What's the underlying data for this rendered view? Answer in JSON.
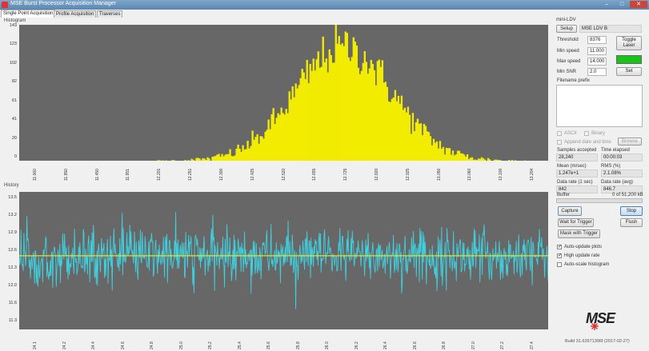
{
  "window": {
    "title": "MSE Burst Processor Acquisition Manager",
    "minimize": "–",
    "maximize": "□",
    "close": "✕"
  },
  "tabs": [
    "Single Point Acquisition",
    "Profile Acquisition",
    "Traverses"
  ],
  "histogram": {
    "label": "Histogram",
    "y_ticks": [
      "143",
      "123",
      "102",
      "82",
      "61",
      "41",
      "20",
      "0"
    ],
    "x_ticks": [
      "11.000",
      "11.950",
      "11.450",
      "11.951",
      "12.201",
      "12.251",
      "12.300",
      "12.425",
      "12.520",
      "12.655",
      "12.725",
      "12.820",
      "12.925",
      "13.050",
      "13.060",
      "13.100",
      "13.204"
    ]
  },
  "history": {
    "label": "History",
    "y_ticks": [
      "13.5",
      "13.2",
      "12.9",
      "12.6",
      "12.3",
      "12.0",
      "11.6",
      "11.3"
    ],
    "x_ticks": [
      "24.1",
      "24.2",
      "24.4",
      "24.6",
      "24.8",
      "25.0",
      "25.2",
      "25.4",
      "25.6",
      "25.8",
      "26.0",
      "26.2",
      "26.4",
      "26.6",
      "26.8",
      "27.0",
      "27.2",
      "27.4"
    ]
  },
  "chart_data": [
    {
      "type": "bar",
      "title": "Histogram",
      "ylim": [
        0,
        143
      ],
      "x_range": [
        11.0,
        13.2
      ],
      "peak_x": 12.35,
      "peak_y": 123,
      "sigma": 0.2
    },
    {
      "type": "line",
      "title": "History",
      "ylim": [
        11.1,
        13.7
      ],
      "mean": 12.5,
      "series_color": "#3fd0e0",
      "mean_color": "#e8e020"
    }
  ],
  "panel": {
    "group_label": "mini-LDV",
    "setup_btn": "Setup",
    "device_name": "MSE LDV B",
    "threshold_label": "Threshold",
    "threshold_value": "8376",
    "min_speed_label": "Min speed",
    "min_speed_value": "11.000",
    "max_speed_label": "Max speed",
    "max_speed_value": "14.000",
    "min_snr_label": "Min SNR",
    "min_snr_value": "2.0",
    "toggle_laser_btn": "Toggle Laser",
    "set_btn": "Set",
    "laser_color": "#19c319",
    "filename_prefix_label": "Filename prefix",
    "ascii_label": "ASCII",
    "binary_label": "Binary",
    "append_label": "Append date and time",
    "browse_btn": "Browse",
    "samples_label": "Samples accepted",
    "samples_value": "28,240",
    "time_label": "Time elapsed",
    "time_value": "00:00:03",
    "mean_label": "Mean (m/sec)",
    "mean_value": "1.247e+1",
    "rms_label": "RMS (%)",
    "rms_value": "2.1.08%",
    "rate1_label": "Data rate (1 sec)",
    "rate1_value": "842",
    "rate_avg_label": "Data rate (avg)",
    "rate_avg_value": "846.7",
    "buffer_label": "Buffer",
    "buffer_value": "0 of 51,200 kB",
    "buffer_fill": 0,
    "capture_btn": "Capture",
    "stop_btn": "Stop",
    "wait_trigger_btn": "Wait for Trigger",
    "flush_btn": "Flush",
    "mask_trigger_btn": "Mask with Trigger",
    "auto_update_label": "Auto-update plots",
    "auto_update_checked": true,
    "high_rate_label": "High update rate",
    "high_rate_checked": true,
    "auto_scale_label": "Auto-scale histogram",
    "auto_scale_checked": false,
    "logo_text": "MSE",
    "build_text": "Build 31.62671396f (2017-02-27)"
  }
}
